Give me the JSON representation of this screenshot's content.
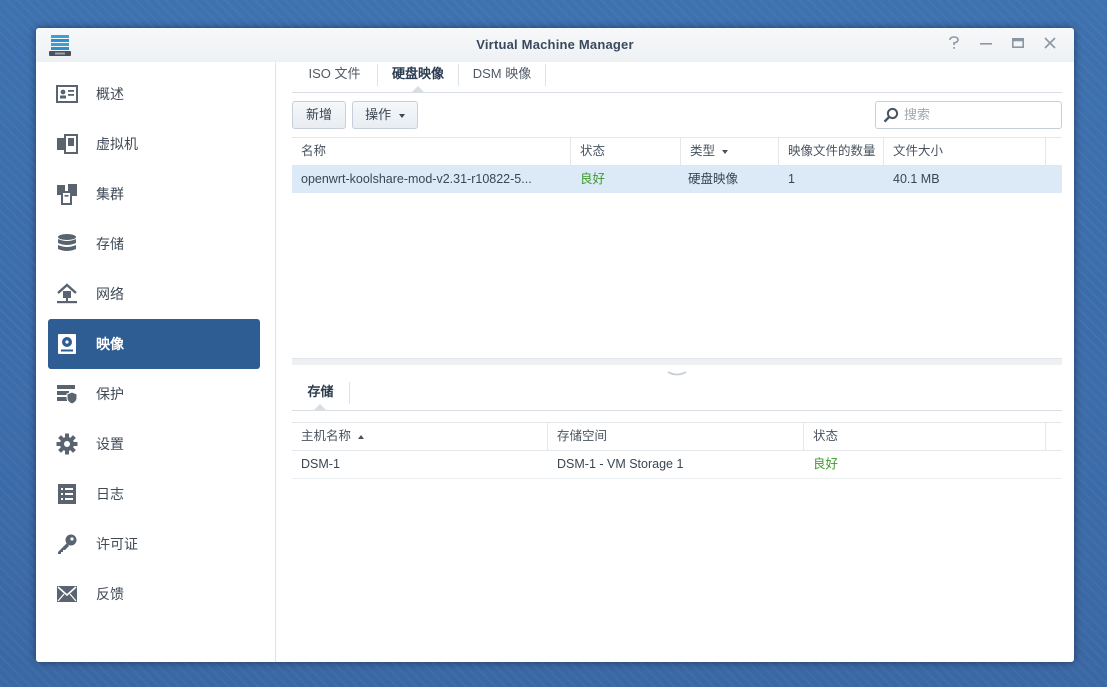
{
  "window": {
    "title": "Virtual Machine Manager",
    "controls": [
      "help-icon",
      "minimize-icon",
      "maximize-icon",
      "close-icon"
    ]
  },
  "sidebar": {
    "items": [
      {
        "label": "概述",
        "icon": "overview-icon",
        "active": false
      },
      {
        "label": "虚拟机",
        "icon": "vm-icon",
        "active": false
      },
      {
        "label": "集群",
        "icon": "cluster-icon",
        "active": false
      },
      {
        "label": "存储",
        "icon": "storage-icon",
        "active": false
      },
      {
        "label": "网络",
        "icon": "network-icon",
        "active": false
      },
      {
        "label": "映像",
        "icon": "image-icon",
        "active": true
      },
      {
        "label": "保护",
        "icon": "protection-icon",
        "active": false
      },
      {
        "label": "设置",
        "icon": "settings-icon",
        "active": false
      },
      {
        "label": "日志",
        "icon": "log-icon",
        "active": false
      },
      {
        "label": "许可证",
        "icon": "license-icon",
        "active": false
      },
      {
        "label": "反馈",
        "icon": "feedback-icon",
        "active": false
      }
    ]
  },
  "tabs": [
    {
      "label": "ISO 文件",
      "active": false
    },
    {
      "label": "硬盘映像",
      "active": true
    },
    {
      "label": "DSM 映像",
      "active": false
    }
  ],
  "toolbar": {
    "new_label": "新增",
    "action_label": "操作"
  },
  "search": {
    "placeholder": "搜索",
    "value": ""
  },
  "images_table": {
    "columns": [
      "名称",
      "状态",
      "类型",
      "映像文件的数量",
      "文件大小"
    ],
    "sorted_column": "类型",
    "sort_direction": "desc",
    "rows": [
      {
        "name": "openwrt-koolshare-mod-v2.31-r10822-5...",
        "status": "良好",
        "type": "硬盘映像",
        "count": "1",
        "size": "40.1 MB",
        "selected": true
      }
    ]
  },
  "storage_panel": {
    "tab_label": "存储",
    "columns": [
      "主机名称",
      "存储空间",
      "状态"
    ],
    "sorted_column": "主机名称",
    "sort_direction": "asc",
    "rows": [
      {
        "host": "DSM-1",
        "volume": "DSM-1 - VM Storage 1",
        "status": "良好"
      }
    ]
  },
  "colors": {
    "accent": "#2e5d93",
    "status_good": "#3c9a2c",
    "selected_row": "#dce9f7",
    "desktop": "#3f6fab"
  }
}
